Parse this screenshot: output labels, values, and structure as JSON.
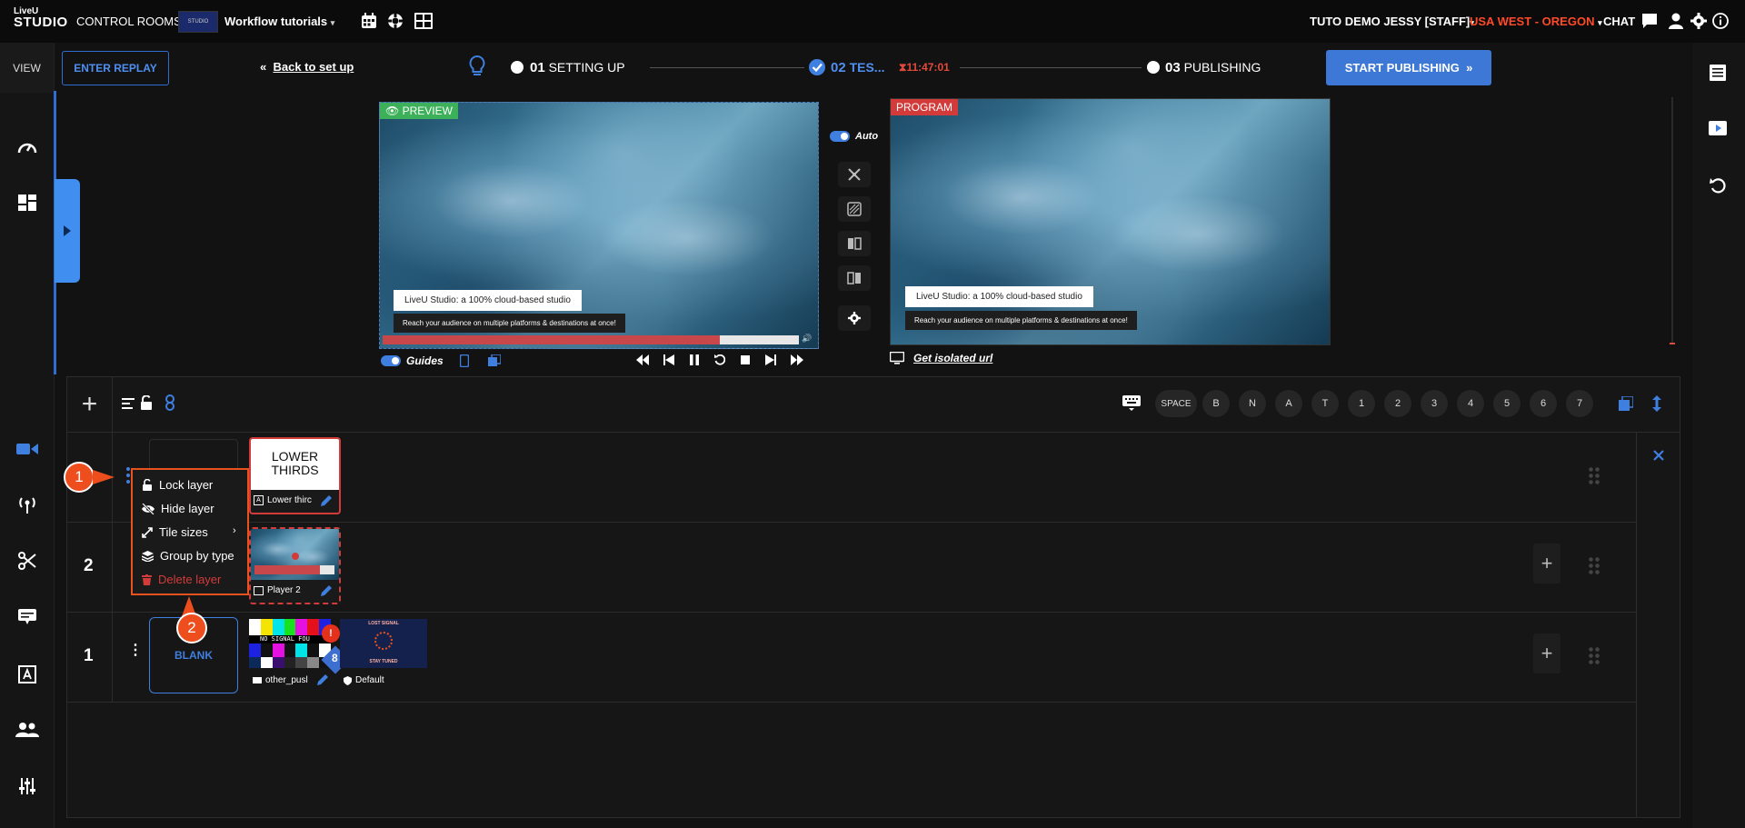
{
  "topbar": {
    "logo_top": "LiveU",
    "logo_bottom": "STUDIO",
    "control_rooms": "CONTROL ROOMS",
    "room_thumb_text": "STUDIO",
    "room_name": "Workflow tutorials",
    "account": "TUTO DEMO JESSY [STAFF]",
    "region": "USA WEST - OREGON",
    "chat": "CHAT"
  },
  "sidebar": {
    "view": "VIEW"
  },
  "controls": {
    "enter_replay": "ENTER REPLAY",
    "back_to_setup": "Back to set up",
    "steps": [
      {
        "num": "01",
        "label": "SETTING UP"
      },
      {
        "num": "02",
        "label": "TES..."
      },
      {
        "num": "03",
        "label": "PUBLISHING"
      }
    ],
    "timer": "11:47:01",
    "start_publishing": "START PUBLISHING"
  },
  "preview": {
    "tag": "PREVIEW",
    "lower_third_title": "LiveU Studio: a 100% cloud-based studio",
    "lower_third_sub": "Reach your audience on multiple platforms & destinations at once!",
    "guides": "Guides",
    "progress": 0.88
  },
  "transition": {
    "auto": "Auto"
  },
  "program": {
    "tag": "PROGRAM",
    "lower_third_title": "LiveU Studio: a 100% cloud-based studio",
    "lower_third_sub": "Reach your audience on multiple platforms & destinations at once!",
    "isolated_url": "Get isolated url"
  },
  "layers_header": {
    "keys": [
      "SPACE",
      "B",
      "N",
      "A",
      "T",
      "1",
      "2",
      "3",
      "4",
      "5",
      "6",
      "7"
    ]
  },
  "layers": {
    "row3": {
      "tile_title_1": "LOWER",
      "tile_title_2": "THIRDS",
      "tile_label": "Lower thirc"
    },
    "row2": {
      "num": "2",
      "tile_label": "Player 2"
    },
    "row1": {
      "num": "1",
      "blank": "BLANK",
      "tile_label": "other_pusl",
      "no_signal": "NO SIGNAL FOU",
      "default_label": "Default",
      "lost_signal": "LOST SIGNAL",
      "stay_tuned": "STAY TUNED"
    }
  },
  "context_menu": {
    "items": [
      "Lock layer",
      "Hide layer",
      "Tile sizes",
      "Group by type",
      "Delete layer"
    ]
  },
  "callouts": [
    "1",
    "2"
  ],
  "colors": {
    "accent": "#2f6dd0",
    "danger": "#e14a3b",
    "region": "#ff4a2a",
    "callout": "#ee4e1e",
    "preview_tag": "#3cb15a",
    "program_tag": "#d33b3b"
  }
}
